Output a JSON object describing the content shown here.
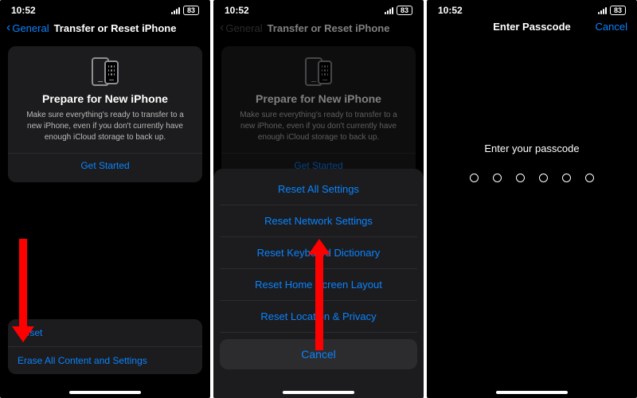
{
  "status": {
    "time": "10:52",
    "battery": "83"
  },
  "nav": {
    "back_label": "General",
    "title": "Transfer or Reset iPhone",
    "passcode_title": "Enter Passcode",
    "cancel": "Cancel"
  },
  "card": {
    "title": "Prepare for New iPhone",
    "body": "Make sure everything's ready to transfer to a new iPhone, even if you don't currently have enough iCloud storage to back up.",
    "action": "Get Started"
  },
  "bottom_options": {
    "reset": "Reset",
    "erase": "Erase All Content and Settings"
  },
  "reset_sheet": {
    "items": [
      "Reset All Settings",
      "Reset Network Settings",
      "Reset Keyboard Dictionary",
      "Reset Home Screen Layout",
      "Reset Location & Privacy"
    ],
    "cancel": "Cancel"
  },
  "passcode": {
    "prompt": "Enter your passcode",
    "digits": 6
  },
  "annotation": {
    "arrow_color": "#ff0000"
  }
}
